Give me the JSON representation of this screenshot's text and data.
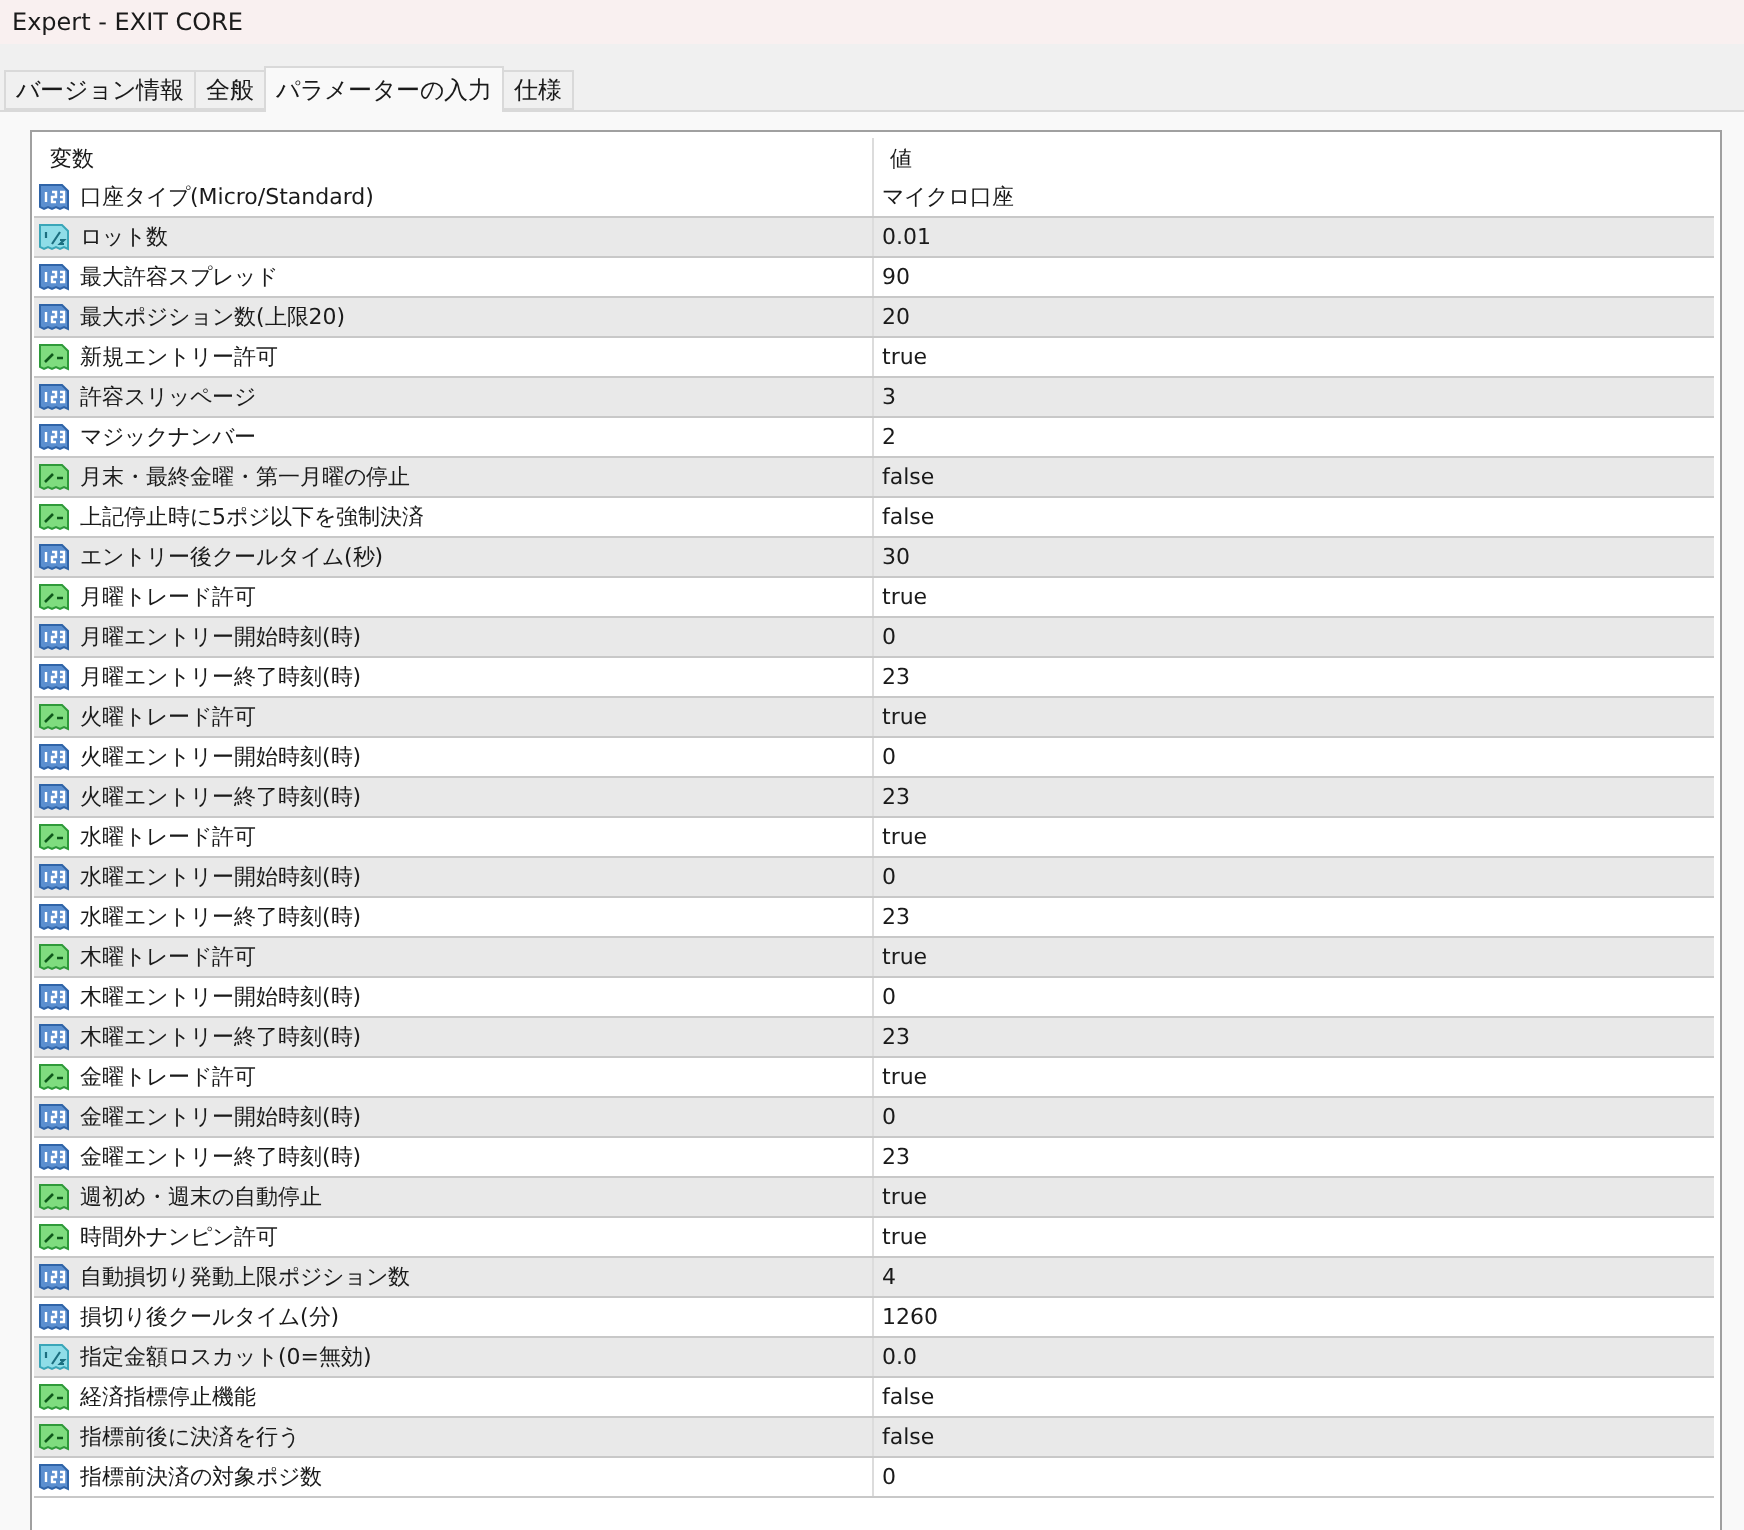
{
  "window": {
    "title": "Expert - EXIT CORE"
  },
  "tabs": [
    {
      "label": "バージョン情報",
      "selected": false
    },
    {
      "label": "全般",
      "selected": false
    },
    {
      "label": "パラメーターの入力",
      "selected": true
    },
    {
      "label": "仕様",
      "selected": false
    }
  ],
  "table": {
    "columns": [
      "変数",
      "値"
    ],
    "rows": [
      {
        "kind": "int",
        "name": "口座タイプ(Micro/Standard)",
        "value": "マイクロ口座"
      },
      {
        "kind": "double",
        "name": "ロット数",
        "value": "0.01"
      },
      {
        "kind": "int",
        "name": "最大許容スプレッド",
        "value": "90"
      },
      {
        "kind": "int",
        "name": "最大ポジション数(上限20)",
        "value": "20"
      },
      {
        "kind": "bool",
        "name": "新規エントリー許可",
        "value": "true"
      },
      {
        "kind": "int",
        "name": "許容スリッページ",
        "value": "3"
      },
      {
        "kind": "int",
        "name": "マジックナンバー",
        "value": "2"
      },
      {
        "kind": "bool",
        "name": "月末・最終金曜・第一月曜の停止",
        "value": "false"
      },
      {
        "kind": "bool",
        "name": "上記停止時に5ポジ以下を強制決済",
        "value": "false"
      },
      {
        "kind": "int",
        "name": "エントリー後クールタイム(秒)",
        "value": "30"
      },
      {
        "kind": "bool",
        "name": "月曜トレード許可",
        "value": "true"
      },
      {
        "kind": "int",
        "name": "月曜エントリー開始時刻(時)",
        "value": "0"
      },
      {
        "kind": "int",
        "name": "月曜エントリー終了時刻(時)",
        "value": "23"
      },
      {
        "kind": "bool",
        "name": "火曜トレード許可",
        "value": "true"
      },
      {
        "kind": "int",
        "name": "火曜エントリー開始時刻(時)",
        "value": "0"
      },
      {
        "kind": "int",
        "name": "火曜エントリー終了時刻(時)",
        "value": "23"
      },
      {
        "kind": "bool",
        "name": "水曜トレード許可",
        "value": "true"
      },
      {
        "kind": "int",
        "name": "水曜エントリー開始時刻(時)",
        "value": "0"
      },
      {
        "kind": "int",
        "name": "水曜エントリー終了時刻(時)",
        "value": "23"
      },
      {
        "kind": "bool",
        "name": "木曜トレード許可",
        "value": "true"
      },
      {
        "kind": "int",
        "name": "木曜エントリー開始時刻(時)",
        "value": "0"
      },
      {
        "kind": "int",
        "name": "木曜エントリー終了時刻(時)",
        "value": "23"
      },
      {
        "kind": "bool",
        "name": "金曜トレード許可",
        "value": "true"
      },
      {
        "kind": "int",
        "name": "金曜エントリー開始時刻(時)",
        "value": "0"
      },
      {
        "kind": "int",
        "name": "金曜エントリー終了時刻(時)",
        "value": "23"
      },
      {
        "kind": "bool",
        "name": "週初め・週末の自動停止",
        "value": "true"
      },
      {
        "kind": "bool",
        "name": "時間外ナンピン許可",
        "value": "true"
      },
      {
        "kind": "int",
        "name": "自動損切り発動上限ポジション数",
        "value": "4"
      },
      {
        "kind": "int",
        "name": "損切り後クールタイム(分)",
        "value": "1260"
      },
      {
        "kind": "double",
        "name": "指定金額ロスカット(0=無効)",
        "value": "0.0"
      },
      {
        "kind": "bool",
        "name": "経済指標停止機能",
        "value": "false"
      },
      {
        "kind": "bool",
        "name": "指標前後に決済を行う",
        "value": "false"
      },
      {
        "kind": "int",
        "name": "指標前決済の対象ポジ数",
        "value": "0"
      }
    ]
  }
}
